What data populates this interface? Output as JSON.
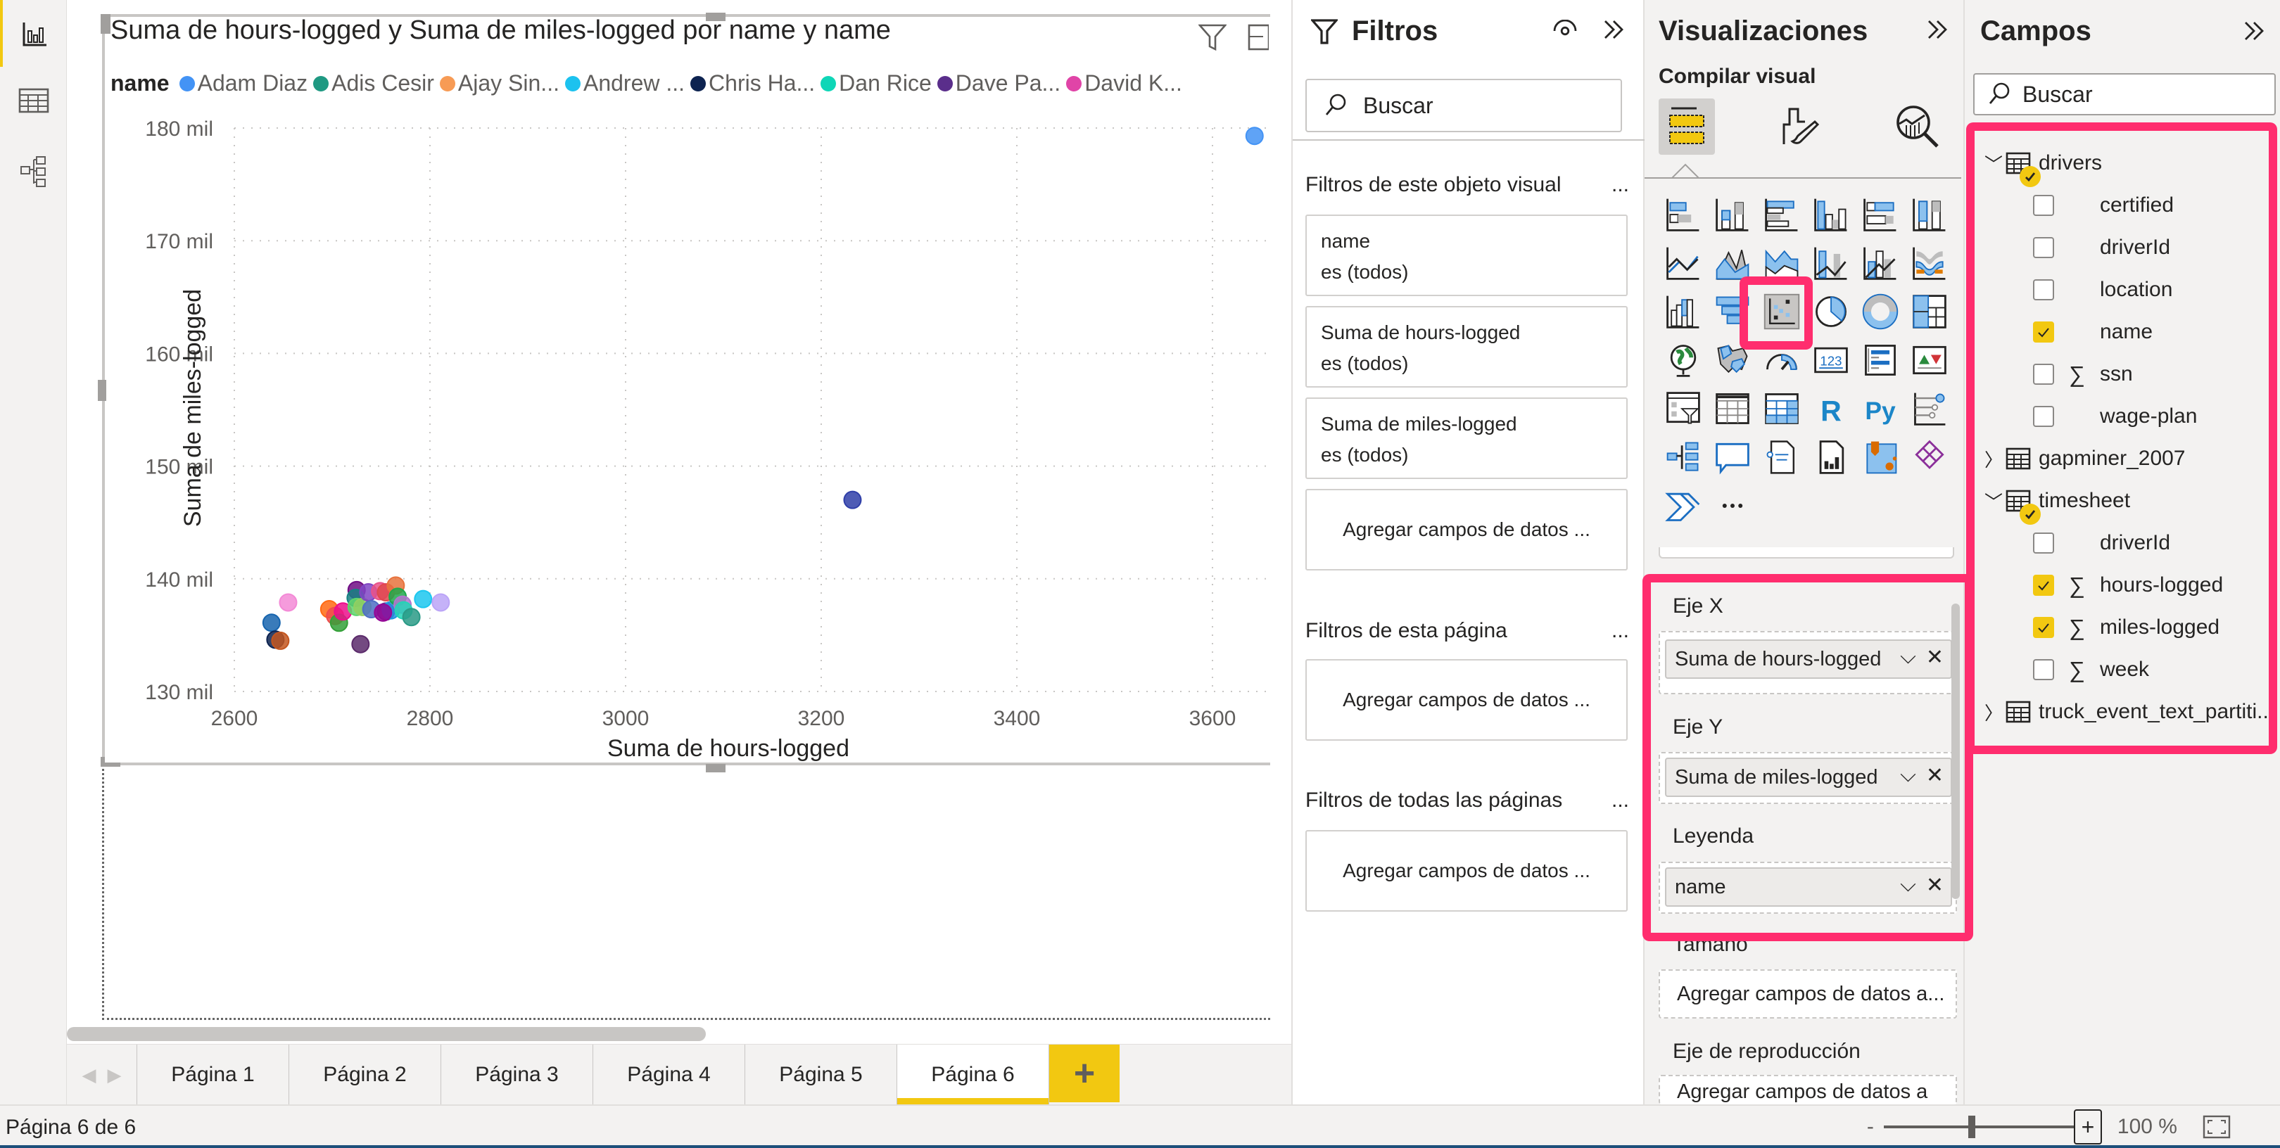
{
  "left_nav": {
    "items": [
      {
        "name": "report-view",
        "active": true
      },
      {
        "name": "data-view",
        "active": false
      },
      {
        "name": "model-view",
        "active": false
      }
    ]
  },
  "visual": {
    "title": "Suma de hours-logged y Suma de miles-logged por name y name",
    "legend_title": "name",
    "legend_items": [
      {
        "label": "Adam Diaz",
        "color": "#4393f5"
      },
      {
        "label": "Adis Cesir",
        "color": "#1f9982"
      },
      {
        "label": "Ajay Sin...",
        "color": "#f79b55"
      },
      {
        "label": "Andrew ...",
        "color": "#1cc2ef"
      },
      {
        "label": "Chris Ha...",
        "color": "#0d2350"
      },
      {
        "label": "Dan Rice",
        "color": "#0fd6b7"
      },
      {
        "label": "Dave Pa...",
        "color": "#5a2e8b"
      },
      {
        "label": "David K...",
        "color": "#e044a7"
      }
    ]
  },
  "chart_data": {
    "type": "scatter",
    "title": "Suma de hours-logged y Suma de miles-logged por name y name",
    "xlabel": "Suma de hours-logged",
    "ylabel": "Suma de miles-logged",
    "xlim": [
      2600,
      3650
    ],
    "ylim": [
      130000,
      180000
    ],
    "x_ticks": [
      2600,
      2800,
      3000,
      3200,
      3400,
      3600
    ],
    "x_tick_labels": [
      "2600",
      "2800",
      "3000",
      "3200",
      "3400",
      "3600"
    ],
    "y_ticks": [
      130000,
      140000,
      150000,
      160000,
      170000,
      180000
    ],
    "y_tick_labels": [
      "130 mil",
      "140 mil",
      "150 mil",
      "160 mil",
      "170 mil",
      "180 mil"
    ],
    "grid": true,
    "legend_position": "top-left",
    "points": [
      {
        "x": 3643,
        "y": 179300,
        "color": "#4393f5"
      },
      {
        "x": 3232,
        "y": 147000,
        "color": "#2f3ea8"
      },
      {
        "x": 2655,
        "y": 137900,
        "color": "#f389d6"
      },
      {
        "x": 2638,
        "y": 136100,
        "color": "#1664ae"
      },
      {
        "x": 2642,
        "y": 134600,
        "color": "#0d2350"
      },
      {
        "x": 2647,
        "y": 134500,
        "color": "#c3561f"
      },
      {
        "x": 2697,
        "y": 137300,
        "color": "#ff6a13"
      },
      {
        "x": 2703,
        "y": 136700,
        "color": "#ee4d4d"
      },
      {
        "x": 2707,
        "y": 136100,
        "color": "#33a038"
      },
      {
        "x": 2711,
        "y": 137100,
        "color": "#ec0f8c"
      },
      {
        "x": 2725,
        "y": 139000,
        "color": "#6f0d84"
      },
      {
        "x": 2724,
        "y": 138300,
        "color": "#168082"
      },
      {
        "x": 2725,
        "y": 137500,
        "color": "#5ed46c"
      },
      {
        "x": 2731,
        "y": 137500,
        "color": "#92cf62"
      },
      {
        "x": 2737,
        "y": 138800,
        "color": "#8045c4"
      },
      {
        "x": 2740,
        "y": 137300,
        "color": "#4e6fc4"
      },
      {
        "x": 2729,
        "y": 134200,
        "color": "#5b2a6b"
      },
      {
        "x": 2749,
        "y": 138900,
        "color": "#e9528a"
      },
      {
        "x": 2755,
        "y": 138800,
        "color": "#e0484e"
      },
      {
        "x": 2755,
        "y": 137100,
        "color": "#5f3b8e"
      },
      {
        "x": 2760,
        "y": 137200,
        "color": "#1f96e0"
      },
      {
        "x": 2765,
        "y": 139400,
        "color": "#e8733d"
      },
      {
        "x": 2767,
        "y": 138400,
        "color": "#1ea84b"
      },
      {
        "x": 2752,
        "y": 137000,
        "color": "#950696"
      },
      {
        "x": 2772,
        "y": 137700,
        "color": "#b275cf"
      },
      {
        "x": 2773,
        "y": 137200,
        "color": "#23d4b6"
      },
      {
        "x": 2781,
        "y": 136600,
        "color": "#2a9a86"
      },
      {
        "x": 2793,
        "y": 138200,
        "color": "#1cc7ef"
      },
      {
        "x": 2811,
        "y": 137900,
        "color": "#bba4f7"
      }
    ]
  },
  "page_tabs": {
    "tabs": [
      "Página 1",
      "Página 2",
      "Página 3",
      "Página 4",
      "Página 5",
      "Página 6"
    ],
    "active_index": 5,
    "add_label": "+"
  },
  "status_bar": {
    "page_info": "Página 6 de 6",
    "zoom_minus": "-",
    "zoom_plus": "+",
    "zoom_level": "100 %",
    "zoom_fraction": 0.5
  },
  "filters": {
    "title": "Filtros",
    "search_placeholder": "Buscar",
    "sections": [
      {
        "title": "Filtros de este objeto visual",
        "cards": [
          {
            "field": "name",
            "state": "es (todos)"
          },
          {
            "field": "Suma de hours-logged",
            "state": "es (todos)"
          },
          {
            "field": "Suma de miles-logged",
            "state": "es (todos)"
          }
        ],
        "add_label": "Agregar campos de datos ..."
      },
      {
        "title": "Filtros de esta página",
        "add_label": "Agregar campos de datos ..."
      },
      {
        "title": "Filtros de todas las páginas",
        "add_label": "Agregar campos de datos ..."
      }
    ],
    "more_label": "..."
  },
  "visualizations": {
    "title": "Visualizaciones",
    "subtitle": "Compilar visual",
    "selected_visual": "scatter-chart",
    "wells": [
      {
        "label": "Eje X",
        "value": "Suma de hours-logged"
      },
      {
        "label": "Eje Y",
        "value": "Suma de miles-logged"
      },
      {
        "label": "Leyenda",
        "value": "name"
      },
      {
        "label": "Tamaño",
        "placeholder": "Agregar campos de datos a..."
      },
      {
        "label": "Eje de reproducción",
        "placeholder": "Agregar campos de datos a"
      }
    ],
    "accent_color": "#ff2d6e"
  },
  "fields": {
    "title": "Campos",
    "search_placeholder": "Buscar",
    "tables": [
      {
        "name": "drivers",
        "expanded": true,
        "has_selection": true,
        "fields": [
          {
            "name": "certified",
            "checked": false,
            "sum": false
          },
          {
            "name": "driverId",
            "checked": false,
            "sum": false
          },
          {
            "name": "location",
            "checked": false,
            "sum": false
          },
          {
            "name": "name",
            "checked": true,
            "sum": false
          },
          {
            "name": "ssn",
            "checked": false,
            "sum": true
          },
          {
            "name": "wage-plan",
            "checked": false,
            "sum": false
          }
        ]
      },
      {
        "name": "gapminer_2007",
        "expanded": false,
        "has_selection": false,
        "fields": []
      },
      {
        "name": "timesheet",
        "expanded": true,
        "has_selection": true,
        "fields": [
          {
            "name": "driverId",
            "checked": false,
            "sum": false
          },
          {
            "name": "hours-logged",
            "checked": true,
            "sum": true
          },
          {
            "name": "miles-logged",
            "checked": true,
            "sum": true
          },
          {
            "name": "week",
            "checked": false,
            "sum": true
          }
        ]
      },
      {
        "name": "truck_event_text_partiti...",
        "expanded": false,
        "has_selection": false,
        "fields": []
      }
    ],
    "sum_symbol": "∑",
    "chevron_expanded": "﹀",
    "chevron_collapsed": "›"
  }
}
